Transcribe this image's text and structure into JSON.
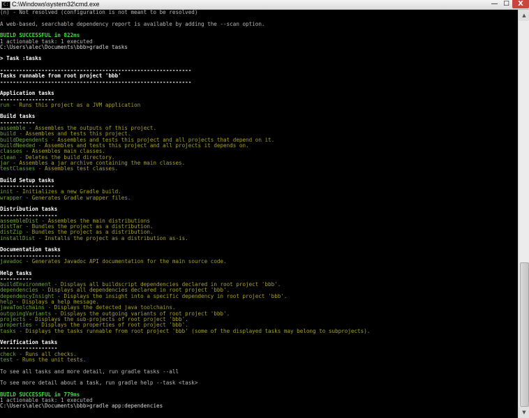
{
  "window": {
    "title": "C:\\Windows\\system32\\cmd.exe",
    "icon": "cmd-icon",
    "controls": {
      "minimize": "—",
      "maximize": "□",
      "close": "X"
    }
  },
  "console": {
    "lines": [
      "(n) - Not resolved (configuration is not meant to be resolved)",
      "",
      "A web-based, searchable dependency report is available by adding the --scan option.",
      "",
      "BUILD SUCCESSFUL in 822ms",
      "1 actionable task: 1 executed",
      "C:\\Users\\alec\\Documents\\bbb>gradle tasks",
      "",
      "> Task :tasks",
      "",
      "------------------------------------------------------------",
      "Tasks runnable from root project 'bbb'",
      "------------------------------------------------------------",
      "",
      "Application tasks",
      "-----------------",
      "run - Runs this project as a JVM application",
      "",
      "Build tasks",
      "-----------",
      "assemble - Assembles the outputs of this project.",
      "build - Assembles and tests this project.",
      "buildDependents - Assembles and tests this project and all projects that depend on it.",
      "buildNeeded - Assembles and tests this project and all projects it depends on.",
      "classes - Assembles main classes.",
      "clean - Deletes the build directory.",
      "jar - Assembles a jar archive containing the main classes.",
      "testClasses - Assembles test classes.",
      "",
      "Build Setup tasks",
      "-----------------",
      "init - Initializes a new Gradle build.",
      "wrapper - Generates Gradle wrapper files.",
      "",
      "Distribution tasks",
      "------------------",
      "assembleDist - Assembles the main distributions",
      "distTar - Bundles the project as a distribution.",
      "distZip - Bundles the project as a distribution.",
      "installDist - Installs the project as a distribution as-is.",
      "",
      "Documentation tasks",
      "-------------------",
      "javadoc - Generates Javadoc API documentation for the main source code.",
      "",
      "Help tasks",
      "----------",
      "buildEnvironment - Displays all buildscript dependencies declared in root project 'bbb'.",
      "dependencies - Displays all dependencies declared in root project 'bbb'.",
      "dependencyInsight - Displays the insight into a specific dependency in root project 'bbb'.",
      "help - Displays a help message.",
      "javaToolchains - Displays the detected java toolchains.",
      "outgoingVariants - Displays the outgoing variants of root project 'bbb'.",
      "projects - Displays the sub-projects of root project 'bbb'.",
      "properties - Displays the properties of root project 'bbb'.",
      "tasks - Displays the tasks runnable from root project 'bbb' (some of the displayed tasks may belong to subprojects).",
      "",
      "Verification tasks",
      "------------------",
      "check - Runs all checks.",
      "test - Runs the unit tests.",
      "",
      "To see all tasks and more detail, run gradle tasks --all",
      "",
      "To see more detail about a task, run gradle help --task <task>",
      "",
      "BUILD SUCCESSFUL in 779ms",
      "1 actionable task: 1 executed",
      "C:\\Users\\alec\\Documents\\bbb>gradle app:dependencies"
    ]
  },
  "colors": {
    "background": "#000000",
    "task_name": "#6ea832",
    "task_description": "#a6a12a",
    "success": "#3ee03e",
    "heading": "#ffffff"
  }
}
